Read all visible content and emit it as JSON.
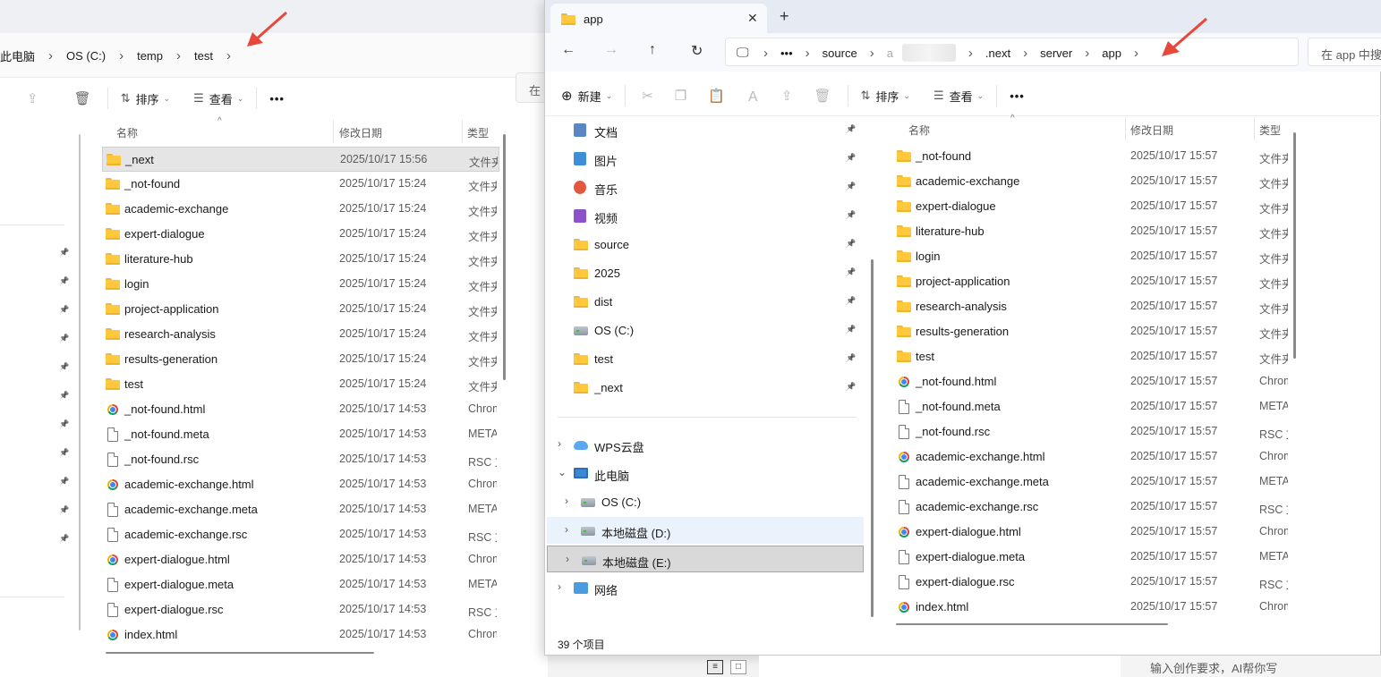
{
  "left_window": {
    "breadcrumb": [
      "此电脑",
      "OS (C:)",
      "temp",
      "test"
    ],
    "search_stub": "在",
    "toolbar": {
      "sort_label": "排序",
      "view_label": "查看",
      "more": "•••"
    },
    "columns": {
      "name": "名称",
      "date": "修改日期",
      "type": "类型"
    },
    "rows": [
      {
        "name": "_next",
        "date": "2025/10/17 15:56",
        "type": "文件夹",
        "icon": "folder"
      },
      {
        "name": "_not-found",
        "date": "2025/10/17 15:24",
        "type": "文件夹",
        "icon": "folder"
      },
      {
        "name": "academic-exchange",
        "date": "2025/10/17 15:24",
        "type": "文件夹",
        "icon": "folder"
      },
      {
        "name": "expert-dialogue",
        "date": "2025/10/17 15:24",
        "type": "文件夹",
        "icon": "folder"
      },
      {
        "name": "literature-hub",
        "date": "2025/10/17 15:24",
        "type": "文件夹",
        "icon": "folder"
      },
      {
        "name": "login",
        "date": "2025/10/17 15:24",
        "type": "文件夹",
        "icon": "folder"
      },
      {
        "name": "project-application",
        "date": "2025/10/17 15:24",
        "type": "文件夹",
        "icon": "folder"
      },
      {
        "name": "research-analysis",
        "date": "2025/10/17 15:24",
        "type": "文件夹",
        "icon": "folder"
      },
      {
        "name": "results-generation",
        "date": "2025/10/17 15:24",
        "type": "文件夹",
        "icon": "folder"
      },
      {
        "name": "test",
        "date": "2025/10/17 15:24",
        "type": "文件夹",
        "icon": "folder"
      },
      {
        "name": "_not-found.html",
        "date": "2025/10/17 14:53",
        "type": "Chrome",
        "icon": "chrome"
      },
      {
        "name": "_not-found.meta",
        "date": "2025/10/17 14:53",
        "type": "META",
        "icon": "file"
      },
      {
        "name": "_not-found.rsc",
        "date": "2025/10/17 14:53",
        "type": "RSC 文",
        "icon": "file"
      },
      {
        "name": "academic-exchange.html",
        "date": "2025/10/17 14:53",
        "type": "Chrome",
        "icon": "chrome"
      },
      {
        "name": "academic-exchange.meta",
        "date": "2025/10/17 14:53",
        "type": "META",
        "icon": "file"
      },
      {
        "name": "academic-exchange.rsc",
        "date": "2025/10/17 14:53",
        "type": "RSC 文",
        "icon": "file"
      },
      {
        "name": "expert-dialogue.html",
        "date": "2025/10/17 14:53",
        "type": "Chrome",
        "icon": "chrome"
      },
      {
        "name": "expert-dialogue.meta",
        "date": "2025/10/17 14:53",
        "type": "META",
        "icon": "file"
      },
      {
        "name": "expert-dialogue.rsc",
        "date": "2025/10/17 14:53",
        "type": "RSC 文",
        "icon": "file"
      },
      {
        "name": "index.html",
        "date": "2025/10/17 14:53",
        "type": "Chrome",
        "icon": "chrome"
      }
    ]
  },
  "right_window": {
    "tab_title": "app",
    "breadcrumb": [
      "•••",
      "source",
      "a",
      ".next",
      "server",
      "app"
    ],
    "search_placeholder": "在 app 中搜",
    "toolbar": {
      "new_label": "新建",
      "sort_label": "排序",
      "view_label": "查看",
      "more": "•••"
    },
    "columns": {
      "name": "名称",
      "date": "修改日期",
      "type": "类型"
    },
    "quick_access": [
      {
        "label": "文档",
        "icon": "documents-icon"
      },
      {
        "label": "图片",
        "icon": "pictures-icon"
      },
      {
        "label": "音乐",
        "icon": "music-icon"
      },
      {
        "label": "视频",
        "icon": "videos-icon"
      },
      {
        "label": "source",
        "icon": "folder-icon"
      },
      {
        "label": "2025",
        "icon": "folder-icon"
      },
      {
        "label": "dist",
        "icon": "folder-icon"
      },
      {
        "label": "OS (C:)",
        "icon": "drive-icon"
      },
      {
        "label": "test",
        "icon": "folder-icon"
      },
      {
        "label": "_next",
        "icon": "folder-icon"
      }
    ],
    "tree": [
      {
        "label": "WPS云盘",
        "icon": "cloud-icon",
        "chevron": "›",
        "indent": 0
      },
      {
        "label": "此电脑",
        "icon": "pc-icon",
        "chevron": "⌄",
        "indent": 0
      },
      {
        "label": "OS (C:)",
        "icon": "drive-icon",
        "chevron": "›",
        "indent": 1
      },
      {
        "label": "本地磁盘 (D:)",
        "icon": "drive-icon",
        "chevron": "›",
        "indent": 1
      },
      {
        "label": "本地磁盘 (E:)",
        "icon": "drive-icon",
        "chevron": "›",
        "indent": 1
      },
      {
        "label": "网络",
        "icon": "network-icon",
        "chevron": "›",
        "indent": 0
      }
    ],
    "rows": [
      {
        "name": "_not-found",
        "date": "2025/10/17 15:57",
        "type": "文件夹",
        "icon": "folder"
      },
      {
        "name": "academic-exchange",
        "date": "2025/10/17 15:57",
        "type": "文件夹",
        "icon": "folder"
      },
      {
        "name": "expert-dialogue",
        "date": "2025/10/17 15:57",
        "type": "文件夹",
        "icon": "folder"
      },
      {
        "name": "literature-hub",
        "date": "2025/10/17 15:57",
        "type": "文件夹",
        "icon": "folder"
      },
      {
        "name": "login",
        "date": "2025/10/17 15:57",
        "type": "文件夹",
        "icon": "folder"
      },
      {
        "name": "project-application",
        "date": "2025/10/17 15:57",
        "type": "文件夹",
        "icon": "folder"
      },
      {
        "name": "research-analysis",
        "date": "2025/10/17 15:57",
        "type": "文件夹",
        "icon": "folder"
      },
      {
        "name": "results-generation",
        "date": "2025/10/17 15:57",
        "type": "文件夹",
        "icon": "folder"
      },
      {
        "name": "test",
        "date": "2025/10/17 15:57",
        "type": "文件夹",
        "icon": "folder"
      },
      {
        "name": "_not-found.html",
        "date": "2025/10/17 15:57",
        "type": "Chrome",
        "icon": "chrome"
      },
      {
        "name": "_not-found.meta",
        "date": "2025/10/17 15:57",
        "type": "META",
        "icon": "file"
      },
      {
        "name": "_not-found.rsc",
        "date": "2025/10/17 15:57",
        "type": "RSC 文",
        "icon": "file"
      },
      {
        "name": "academic-exchange.html",
        "date": "2025/10/17 15:57",
        "type": "Chrome",
        "icon": "chrome"
      },
      {
        "name": "academic-exchange.meta",
        "date": "2025/10/17 15:57",
        "type": "META",
        "icon": "file"
      },
      {
        "name": "academic-exchange.rsc",
        "date": "2025/10/17 15:57",
        "type": "RSC 文",
        "icon": "file"
      },
      {
        "name": "expert-dialogue.html",
        "date": "2025/10/17 15:57",
        "type": "Chrome",
        "icon": "chrome"
      },
      {
        "name": "expert-dialogue.meta",
        "date": "2025/10/17 15:57",
        "type": "META",
        "icon": "file"
      },
      {
        "name": "expert-dialogue.rsc",
        "date": "2025/10/17 15:57",
        "type": "RSC 文",
        "icon": "file"
      },
      {
        "name": "index.html",
        "date": "2025/10/17 15:57",
        "type": "Chrome",
        "icon": "chrome"
      }
    ],
    "status_text": "39 个项目"
  },
  "bottom_bar": {
    "ai_prompt": "输入创作要求，AI帮你写"
  },
  "colors": {
    "folder": "#ffc83d",
    "selection": "#cde8ff",
    "annotation_arrow": "#e8473b"
  }
}
